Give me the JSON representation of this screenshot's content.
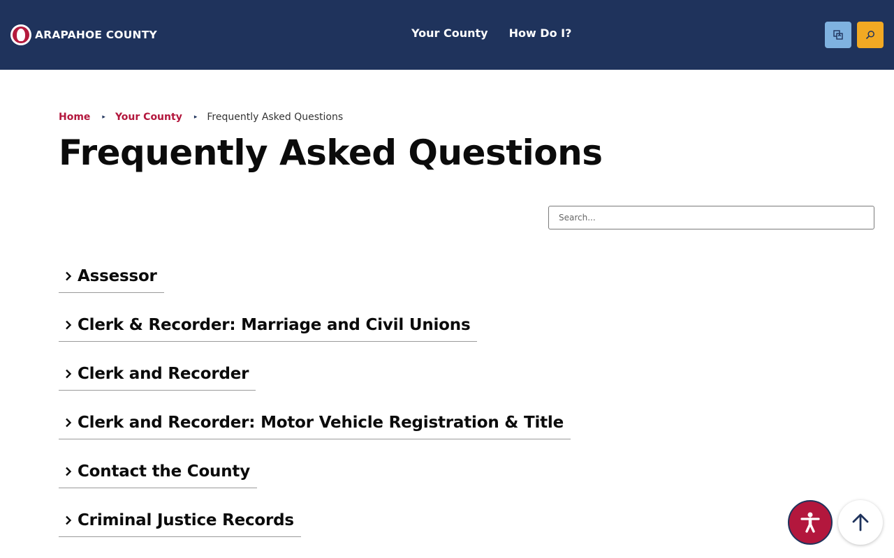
{
  "header": {
    "logo_text": "ARAPAHOE COUNTY",
    "nav": [
      {
        "label": "Your County"
      },
      {
        "label": "How Do I?"
      }
    ],
    "translate_icon": "translate-icon",
    "search_icon": "search-icon"
  },
  "breadcrumb": {
    "home": "Home",
    "parent": "Your County",
    "current": "Frequently Asked Questions"
  },
  "page_title": "Frequently Asked Questions",
  "search": {
    "placeholder": "Search..."
  },
  "faq_categories": [
    {
      "label": "Assessor"
    },
    {
      "label": "Clerk & Recorder: Marriage and Civil Unions"
    },
    {
      "label": "Clerk and Recorder"
    },
    {
      "label": "Clerk and Recorder: Motor Vehicle Registration & Title"
    },
    {
      "label": "Contact the County"
    },
    {
      "label": "Criminal Justice Records"
    }
  ],
  "colors": {
    "header_bg": "#1f335c",
    "accent_red": "#b3173d",
    "translate_btn": "#7fb2e0",
    "search_btn": "#f2a923"
  },
  "floating": {
    "accessibility_icon": "accessibility-icon",
    "back_to_top_icon": "arrow-up-icon"
  }
}
